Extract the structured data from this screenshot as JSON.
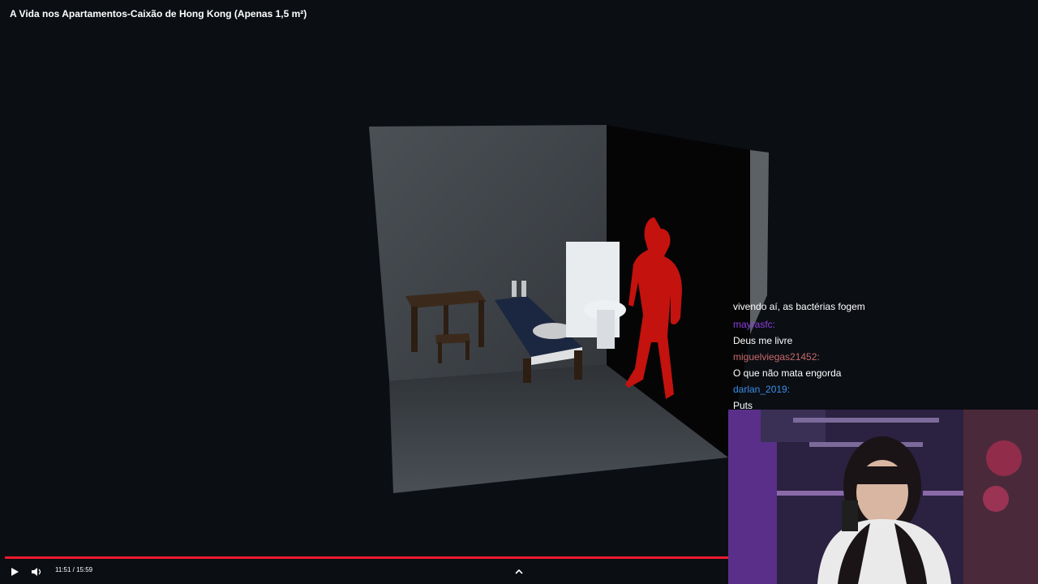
{
  "video": {
    "title": "A Vida nos Apartamentos-Caixão de Hong Kong (Apenas 1,5 m²)",
    "time": "11:51 / 15:59",
    "progress_fraction": 0.74
  },
  "chat": [
    {
      "user": "",
      "message": "vivendo aí, as bactérias fogem",
      "color": "#ffffff"
    },
    {
      "user": "mayrasfc:",
      "message": "Deus me livre",
      "color": "#8a3fe0"
    },
    {
      "user": "miguelviegas21452:",
      "message": "O que não mata engorda",
      "color": "#c86a6a"
    },
    {
      "user": "darlan_2019:",
      "message": "Puts",
      "color": "#3b8ee8"
    }
  ],
  "icons": {
    "play": "play-icon",
    "volume": "volume-icon",
    "expand": "chevron-up-icon",
    "pause_overlay": "pause-icon"
  }
}
